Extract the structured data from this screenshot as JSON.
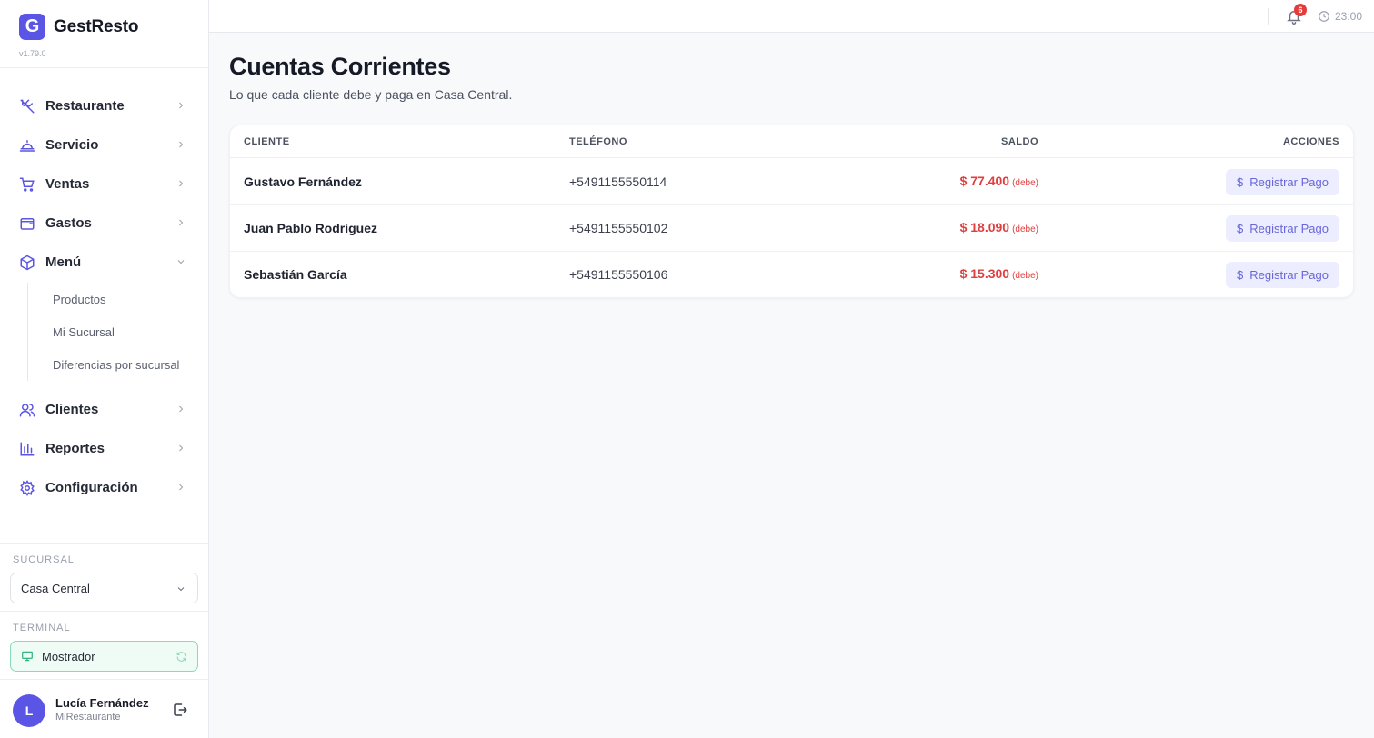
{
  "app": {
    "name": "GestResto",
    "logo_letter": "G",
    "version": "v1.79.0"
  },
  "colors": {
    "accent": "#5b55e6",
    "debt": "#e03e3e",
    "terminal_border": "#86dcb8",
    "badge": "#e53b3b"
  },
  "nav": {
    "items": [
      {
        "label": "Restaurante",
        "icon": "utensils-icon"
      },
      {
        "label": "Servicio",
        "icon": "cloche-icon"
      },
      {
        "label": "Ventas",
        "icon": "cart-icon"
      },
      {
        "label": "Gastos",
        "icon": "wallet-icon"
      },
      {
        "label": "Menú",
        "icon": "box-icon",
        "expanded": true
      },
      {
        "label": "Clientes",
        "icon": "users-icon"
      },
      {
        "label": "Reportes",
        "icon": "bar-chart-icon"
      },
      {
        "label": "Configuración",
        "icon": "gear-icon"
      }
    ],
    "menu_subitems": [
      "Productos",
      "Mi Sucursal",
      "Diferencias por sucursal"
    ]
  },
  "branch": {
    "label": "SUCURSAL",
    "value": "Casa Central"
  },
  "terminal": {
    "label": "TERMINAL",
    "value": "Mostrador"
  },
  "user": {
    "initial": "L",
    "name": "Lucía Fernández",
    "org": "MiRestaurante"
  },
  "topbar": {
    "notifications": "6",
    "time": "23:00"
  },
  "page": {
    "title": "Cuentas Corrientes",
    "subtitle": "Lo que cada cliente debe y paga en Casa Central."
  },
  "table": {
    "headers": {
      "client": "CLIENTE",
      "phone": "TELÉFONO",
      "balance": "SALDO",
      "actions": "ACCIONES"
    },
    "rows": [
      {
        "name": "Gustavo Fernández",
        "phone": "+5491155550114",
        "balance": "$ 77.400",
        "status": "(debe)",
        "action": "Registrar Pago"
      },
      {
        "name": "Juan Pablo Rodríguez",
        "phone": "+5491155550102",
        "balance": "$ 18.090",
        "status": "(debe)",
        "action": "Registrar Pago"
      },
      {
        "name": "Sebastián García",
        "phone": "+5491155550106",
        "balance": "$ 15.300",
        "status": "(debe)",
        "action": "Registrar Pago"
      }
    ]
  }
}
